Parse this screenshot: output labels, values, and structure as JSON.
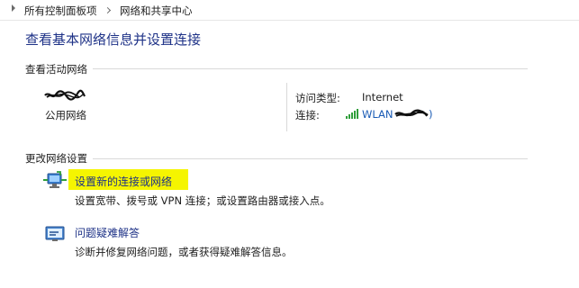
{
  "breadcrumb": {
    "items": [
      "所有控制面板项",
      "网络和共享中心"
    ]
  },
  "page": {
    "title": "查看基本网络信息并设置连接"
  },
  "active_networks": {
    "section_label": "查看活动网络",
    "network_type": "公用网络",
    "access_type_label": "访问类型:",
    "access_type_value": "Internet",
    "connection_label": "连接:",
    "connection_value": "WLAN",
    "connection_suffix": ")"
  },
  "change_settings": {
    "section_label": "更改网络设置",
    "tasks": [
      {
        "title": "设置新的连接或网络",
        "description": "设置宽带、拨号或 VPN 连接；或设置路由器或接入点。",
        "highlighted": true
      },
      {
        "title": "问题疑难解答",
        "description": "诊断并修复网络问题，或者获得疑难解答信息。"
      }
    ]
  },
  "colors": {
    "title_blue": "#1e3287",
    "link_blue": "#1a5bb5",
    "highlight_yellow": "#f5f500",
    "divider": "#d9d9d9"
  }
}
